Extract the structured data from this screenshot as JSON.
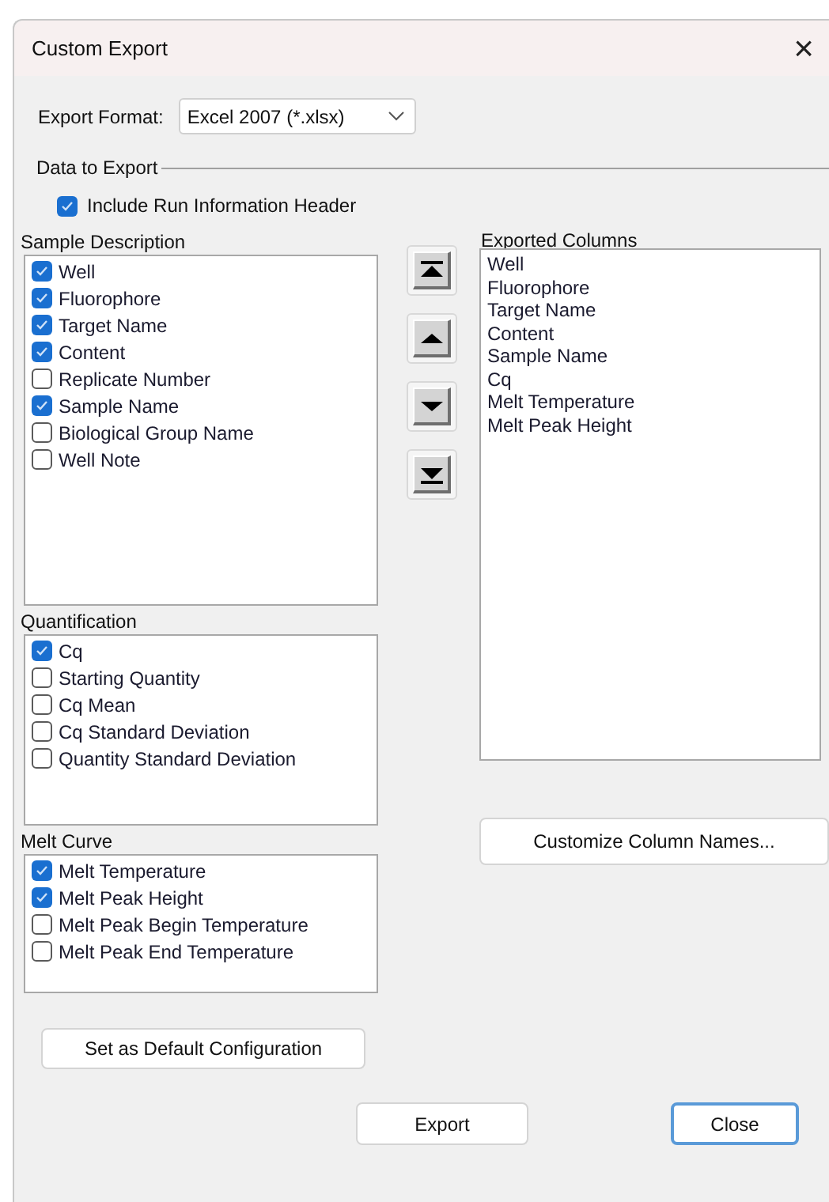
{
  "window": {
    "title": "Custom Export",
    "close_label": "×"
  },
  "export_format": {
    "label": "Export Format:",
    "value": "Excel 2007 (*.xlsx)"
  },
  "data_to_export": {
    "label": "Data to Export",
    "include_header": {
      "label": "Include Run Information Header",
      "checked": true
    }
  },
  "groups": [
    {
      "title": "Sample Description",
      "items": [
        {
          "label": "Well",
          "checked": true
        },
        {
          "label": "Fluorophore",
          "checked": true
        },
        {
          "label": "Target Name",
          "checked": true
        },
        {
          "label": "Content",
          "checked": true
        },
        {
          "label": "Replicate Number",
          "checked": false
        },
        {
          "label": "Sample Name",
          "checked": true
        },
        {
          "label": "Biological Group Name",
          "checked": false
        },
        {
          "label": "Well Note",
          "checked": false
        }
      ]
    },
    {
      "title": "Quantification",
      "items": [
        {
          "label": "Cq",
          "checked": true
        },
        {
          "label": "Starting Quantity",
          "checked": false
        },
        {
          "label": "Cq Mean",
          "checked": false
        },
        {
          "label": "Cq Standard Deviation",
          "checked": false
        },
        {
          "label": "Quantity Standard Deviation",
          "checked": false
        }
      ]
    },
    {
      "title": "Melt Curve",
      "items": [
        {
          "label": "Melt Temperature",
          "checked": true
        },
        {
          "label": "Melt Peak Height",
          "checked": true
        },
        {
          "label": "Melt Peak Begin Temperature",
          "checked": false
        },
        {
          "label": "Melt Peak End Temperature",
          "checked": false
        }
      ]
    }
  ],
  "move_buttons": [
    {
      "kind": "top"
    },
    {
      "kind": "up"
    },
    {
      "kind": "down"
    },
    {
      "kind": "bottom"
    }
  ],
  "exported_columns": {
    "title": "Exported Columns",
    "items": [
      "Well",
      "Fluorophore",
      "Target Name",
      "Content",
      "Sample Name",
      "Cq",
      "Melt Temperature",
      "Melt Peak Height"
    ]
  },
  "buttons": {
    "customize": "Customize Column Names...",
    "set_default": "Set as Default Configuration",
    "export": "Export",
    "close": "Close"
  }
}
